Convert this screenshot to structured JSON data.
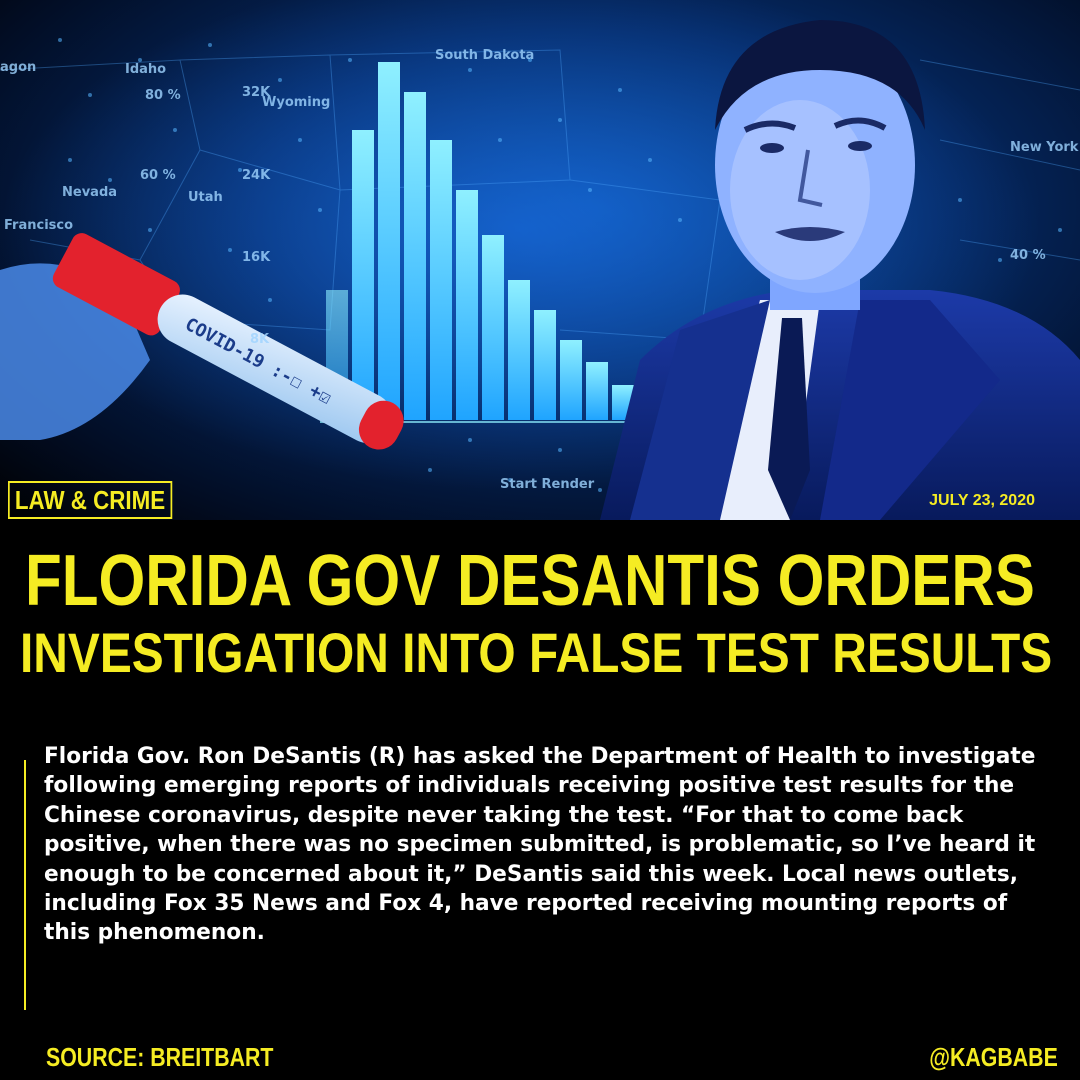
{
  "header": {
    "category": "LAW & CRIME",
    "date": "JULY 23, 2020"
  },
  "headline": {
    "line1": "FLORIDA GOV DESANTIS ORDERS",
    "line2": "INVESTIGATION INTO FALSE TEST RESULTS"
  },
  "body": {
    "text": "Florida Gov. Ron DeSantis (R) has asked the Department of Health to investigate following emerging reports of individuals receiving positive test results for the Chinese coronavirus, despite never taking the test. “For that to come back positive, when there was no specimen submitted, is problematic, so I’ve heard it enough to be concerned about it,” DeSantis said this week. Local news outlets, including Fox 35 News and Fox 4, have reported receiving mounting reports of this phenomenon."
  },
  "footer": {
    "source": "SOURCE: BREITBART",
    "handle": "@KAGBABE"
  },
  "image": {
    "tube_label": "COVID-19 :-☐ +☑",
    "map_labels": [
      "Idaho",
      "South Dakota",
      "Nevada",
      "Utah",
      "Francisco",
      "New York",
      "80 %",
      "60 %",
      "40 %",
      "32K",
      "24K",
      "16K",
      "8K",
      "Start Render",
      "Wyoming"
    ]
  },
  "colors": {
    "accent": "#f5ec23",
    "background": "#000000",
    "photo_blue": "#0a4a9a"
  }
}
